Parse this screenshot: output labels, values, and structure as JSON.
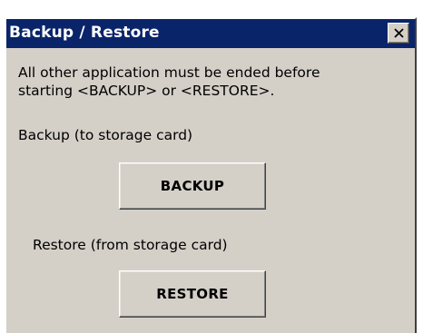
{
  "window": {
    "title": "Backup / Restore"
  },
  "message": {
    "line1": "All other application must be ended before",
    "line2": "starting <BACKUP> or <RESTORE>."
  },
  "backup": {
    "label": "Backup (to storage card)",
    "button": "BACKUP"
  },
  "restore": {
    "label": "Restore (from storage card)",
    "button": "RESTORE"
  },
  "icons": {
    "close": "close-icon"
  },
  "colors": {
    "titlebar": "#0a246a",
    "title_text": "#ffffff",
    "window_bg": "#d4d0c8"
  }
}
